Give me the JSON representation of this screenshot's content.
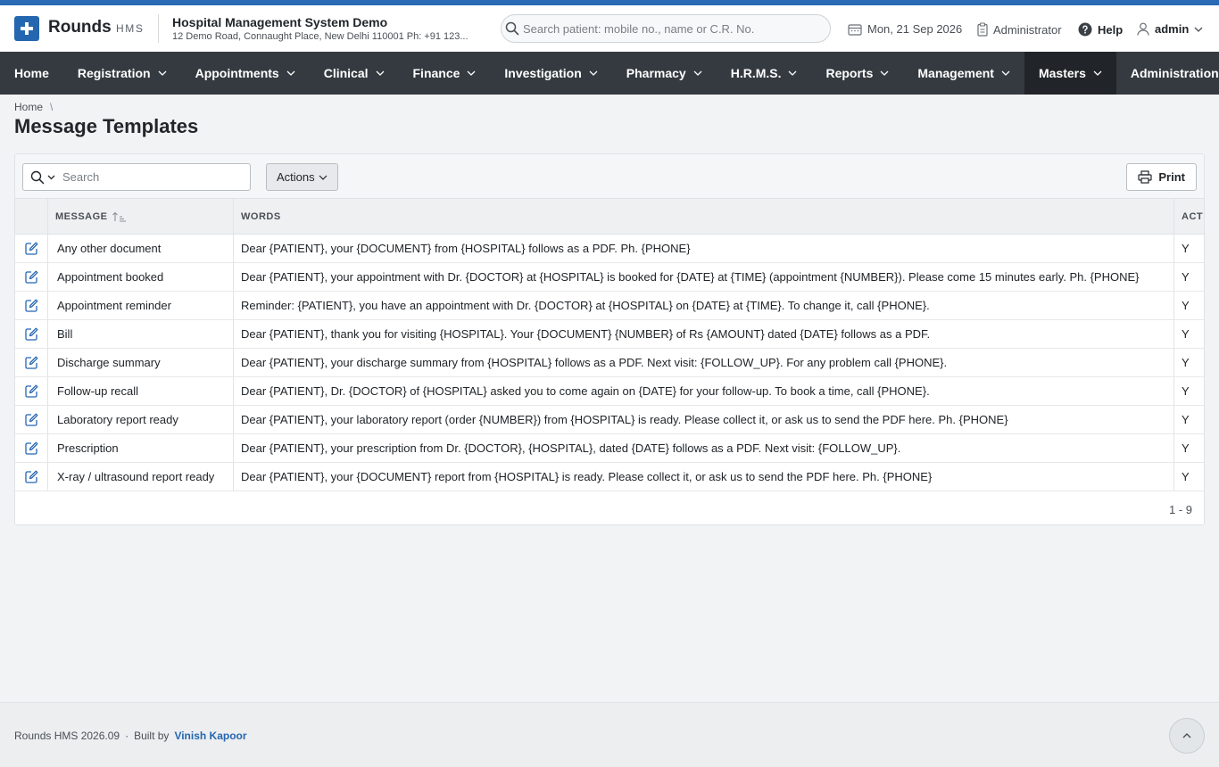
{
  "app": {
    "name": "Rounds",
    "suffix": "HMS",
    "hospital_name": "Hospital Management System Demo",
    "hospital_address": "12 Demo Road, Connaught Place, New Delhi 110001 Ph: +91 123..."
  },
  "header": {
    "search_placeholder": "Search patient: mobile no., name or C.R. No.",
    "date": "Mon, 21 Sep 2026",
    "role": "Administrator",
    "help": "Help",
    "user": "admin"
  },
  "nav": {
    "items": [
      {
        "label": "Home",
        "has_menu": false,
        "active": false
      },
      {
        "label": "Registration",
        "has_menu": true,
        "active": false
      },
      {
        "label": "Appointments",
        "has_menu": true,
        "active": false
      },
      {
        "label": "Clinical",
        "has_menu": true,
        "active": false
      },
      {
        "label": "Finance",
        "has_menu": true,
        "active": false
      },
      {
        "label": "Investigation",
        "has_menu": true,
        "active": false
      },
      {
        "label": "Pharmacy",
        "has_menu": true,
        "active": false
      },
      {
        "label": "H.R.M.S.",
        "has_menu": true,
        "active": false
      },
      {
        "label": "Reports",
        "has_menu": true,
        "active": false
      },
      {
        "label": "Management",
        "has_menu": true,
        "active": false
      },
      {
        "label": "Masters",
        "has_menu": true,
        "active": true
      },
      {
        "label": "Administration",
        "has_menu": true,
        "active": false
      }
    ]
  },
  "breadcrumb": {
    "home": "Home",
    "separator": "\\"
  },
  "page": {
    "title": "Message Templates"
  },
  "toolbar": {
    "search_placeholder": "Search",
    "actions_label": "Actions",
    "print_label": "Print"
  },
  "grid": {
    "columns": {
      "message": "MESSAGE",
      "words": "WORDS",
      "active": "ACT"
    },
    "rows": [
      {
        "message": "Any other document",
        "words": "Dear {PATIENT}, your {DOCUMENT} from {HOSPITAL} follows as a PDF. Ph. {PHONE}",
        "active": "Y"
      },
      {
        "message": "Appointment booked",
        "words": "Dear {PATIENT}, your appointment with Dr. {DOCTOR} at {HOSPITAL} is booked for {DATE} at {TIME} (appointment {NUMBER}). Please come 15 minutes early. Ph. {PHONE}",
        "active": "Y"
      },
      {
        "message": "Appointment reminder",
        "words": "Reminder: {PATIENT}, you have an appointment with Dr. {DOCTOR} at {HOSPITAL} on {DATE} at {TIME}. To change it, call {PHONE}.",
        "active": "Y"
      },
      {
        "message": "Bill",
        "words": "Dear {PATIENT}, thank you for visiting {HOSPITAL}. Your {DOCUMENT} {NUMBER} of Rs {AMOUNT} dated {DATE} follows as a PDF.",
        "active": "Y"
      },
      {
        "message": "Discharge summary",
        "words": "Dear {PATIENT}, your discharge summary from {HOSPITAL} follows as a PDF. Next visit: {FOLLOW_UP}. For any problem call {PHONE}.",
        "active": "Y"
      },
      {
        "message": "Follow-up recall",
        "words": "Dear {PATIENT}, Dr. {DOCTOR} of {HOSPITAL} asked you to come again on {DATE} for your follow-up. To book a time, call {PHONE}.",
        "active": "Y"
      },
      {
        "message": "Laboratory report ready",
        "words": "Dear {PATIENT}, your laboratory report (order {NUMBER}) from {HOSPITAL} is ready. Please collect it, or ask us to send the PDF here. Ph. {PHONE}",
        "active": "Y"
      },
      {
        "message": "Prescription",
        "words": "Dear {PATIENT}, your prescription from Dr. {DOCTOR}, {HOSPITAL}, dated {DATE} follows as a PDF. Next visit: {FOLLOW_UP}.",
        "active": "Y"
      },
      {
        "message": "X-ray / ultrasound report ready",
        "words": "Dear {PATIENT}, your {DOCUMENT} report from {HOSPITAL} is ready. Please collect it, or ask us to send the PDF here. Ph. {PHONE}",
        "active": "Y"
      }
    ],
    "pagination": "1 - 9"
  },
  "footer": {
    "version": "Rounds HMS 2026.09",
    "separator": "·",
    "built_by": "Built by",
    "author": "Vinish Kapoor"
  },
  "icons": {
    "logo": "plus-icon",
    "search": "search-icon",
    "calendar": "calendar-icon",
    "role": "clipboard-icon",
    "help": "question-circle-icon",
    "user": "user-icon",
    "dropdown": "chevron-down-icon",
    "edit": "edit-icon",
    "sort": "sort-ascending-icon",
    "print": "printer-icon",
    "scroll_top": "chevron-up-icon"
  },
  "colors": {
    "brand": "#2566b0",
    "accent_bar": "#2a6ab5",
    "nav_bg": "#343a40",
    "nav_active": "#212529"
  }
}
